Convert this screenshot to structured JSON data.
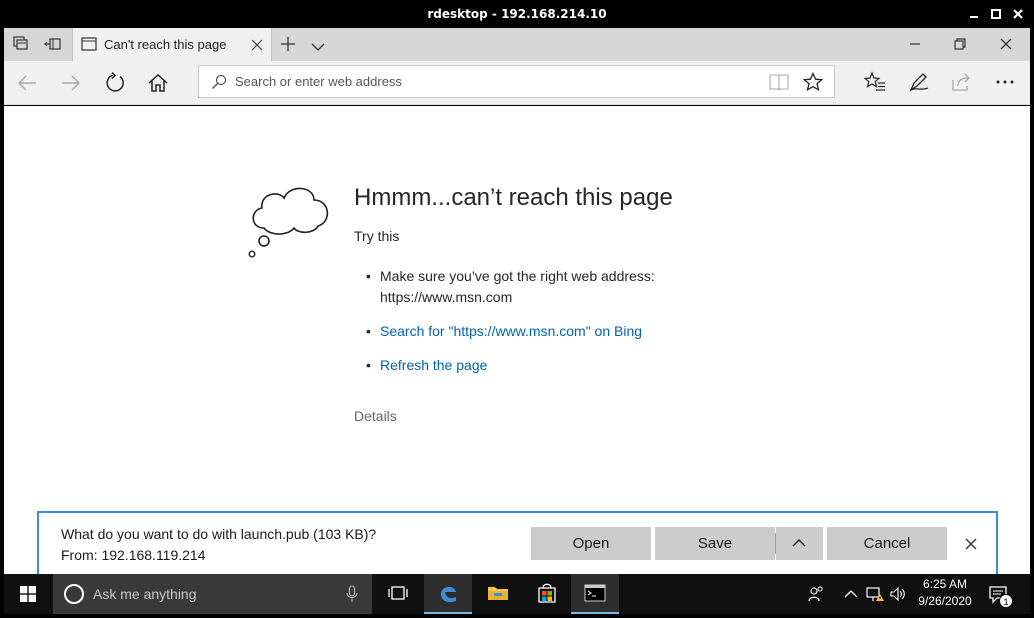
{
  "rdesktop": {
    "title": "rdesktop - 192.168.214.10"
  },
  "browser": {
    "tab": {
      "label": "Can't reach this page"
    },
    "address_bar": {
      "placeholder": "Search or enter web address",
      "value": ""
    }
  },
  "error_page": {
    "title": "Hmmm...can’t reach this page",
    "try_this": "Try this",
    "bullets": {
      "check_address": "Make sure you’ve got the right web address: https://www.msn.com",
      "search_bing": "Search for \"https://www.msn.com\" on Bing",
      "refresh": "Refresh the page"
    },
    "details": "Details"
  },
  "download_bar": {
    "question": "What do you want to do with launch.pub (103 KB)?",
    "from": "From: 192.168.119.214",
    "open_label": "Open",
    "save_label": "Save",
    "cancel_label": "Cancel"
  },
  "taskbar": {
    "search_placeholder": "Ask me anything",
    "time": "6:25 AM",
    "date": "9/26/2020",
    "notification_count": "1"
  },
  "colors": {
    "link": "#0063b1",
    "download_border": "#3b8fd8",
    "taskbar": "#101010",
    "tab_bar": "#d6d6d6"
  }
}
